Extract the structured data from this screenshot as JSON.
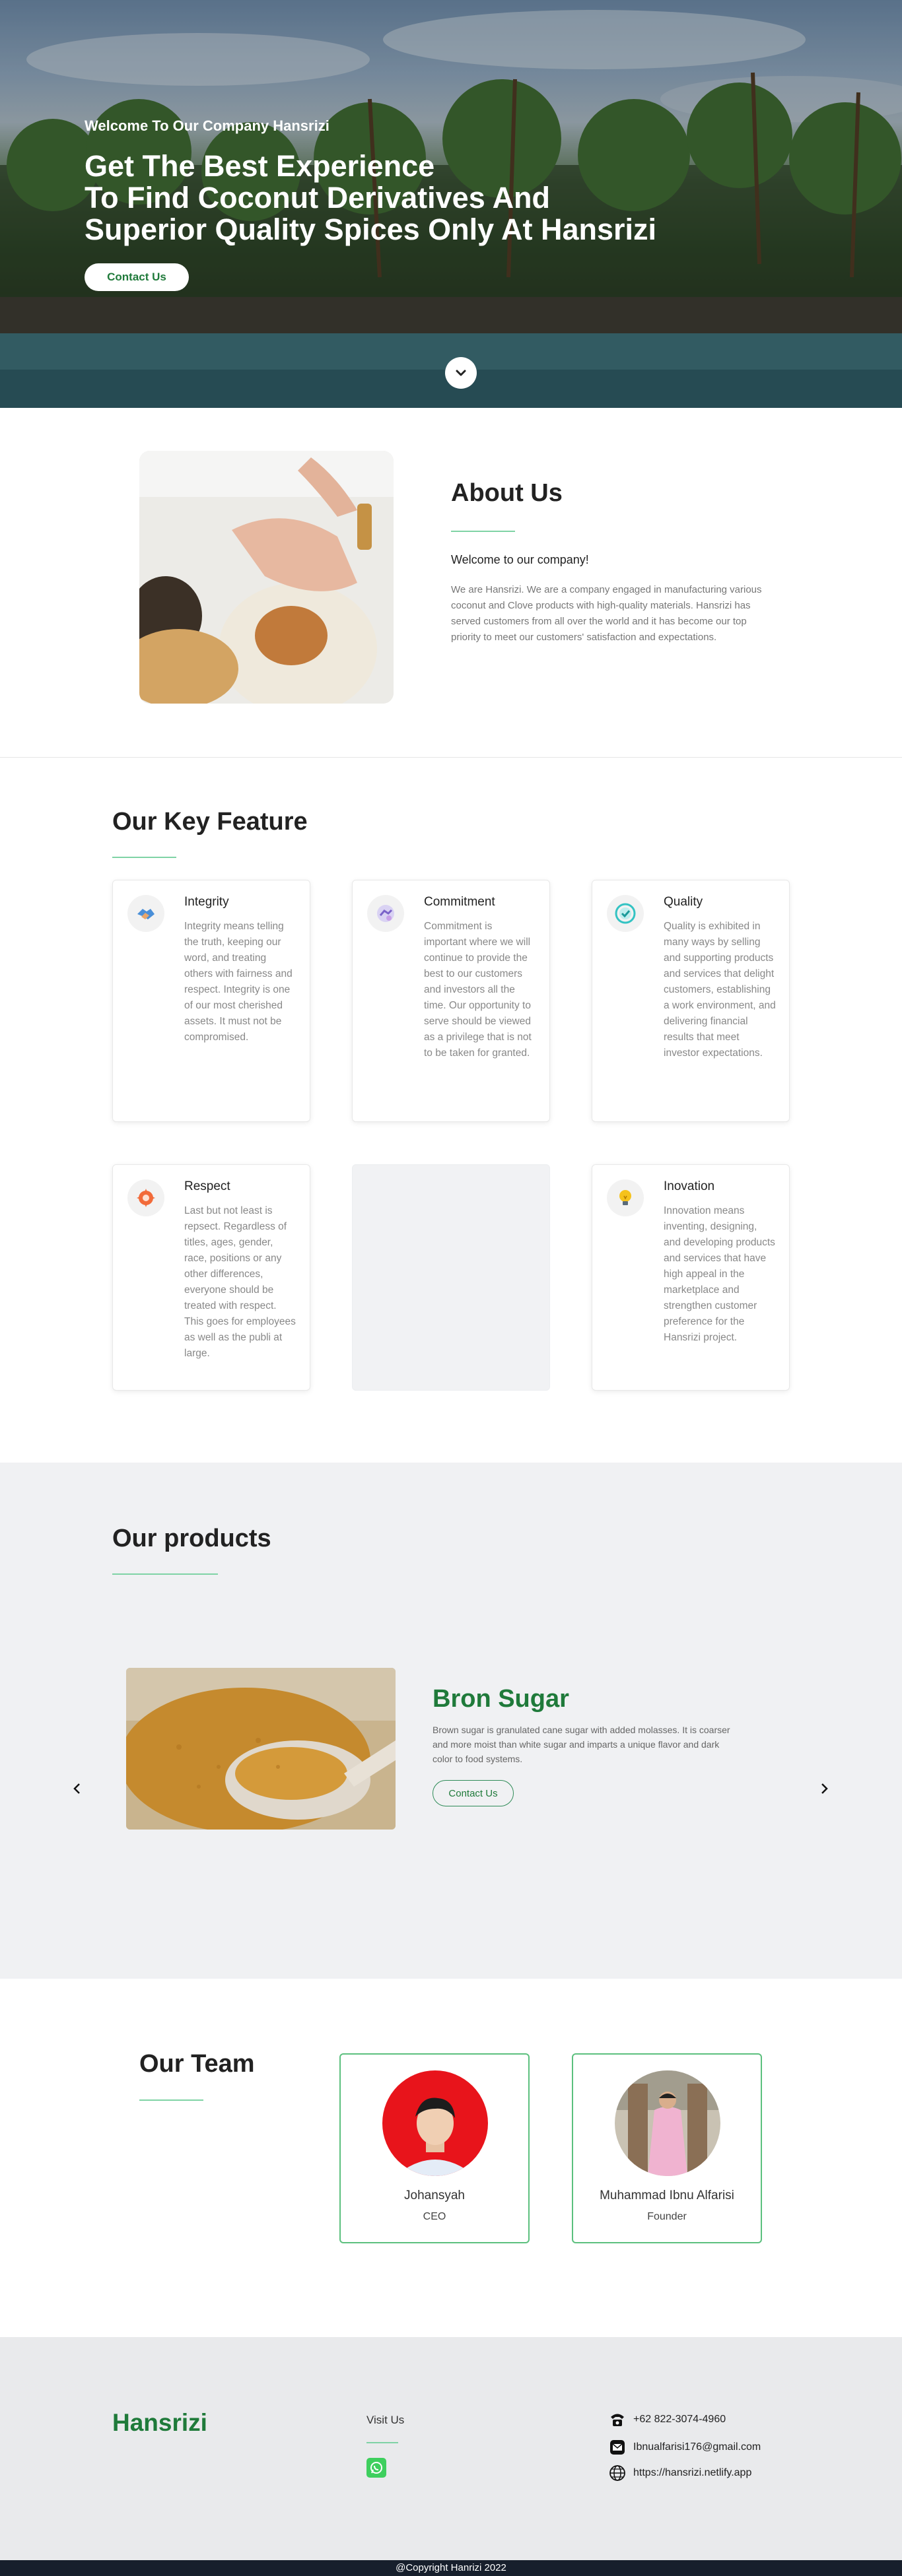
{
  "hero": {
    "subtitle": "Welcome To Our Company Hansrizi",
    "title_lines": [
      "Get The Best Experience",
      "To Find Coconut Derivatives And",
      "Superior Quality Spices Only At Hansrizi"
    ],
    "cta_label": "Contact Us",
    "scroll_icon": "chevron-down-icon"
  },
  "about": {
    "title": "About Us",
    "welcome": "Welcome to our company!",
    "text": "We are Hansrizi. We are a company engaged in manufacturing various coconut and Clove products with high-quality materials. Hansrizi has served customers from all over the world and it has become our top priority to meet our customers' satisfaction and expectations."
  },
  "features": {
    "title": "Our Key Feature",
    "items": [
      {
        "title": "Integrity",
        "icon": "handshake-icon",
        "text": "Integrity means telling the truth, keeping our word, and treating others with fairness and respect. Integrity is one of our most cherished assets. It must not be compromised."
      },
      {
        "title": "Commitment",
        "icon": "commitment-icon",
        "text": "Commitment is important where we will continue to provide the best to our customers and investors all the time. Our opportunity to serve should be viewed as a privilege that is not to be taken for granted."
      },
      {
        "title": "Quality",
        "icon": "quality-check-icon",
        "text": "Quality is exhibited in many ways by selling and supporting products and services that delight customers, establishing a work environment, and delivering financial results that meet investor expectations."
      },
      {
        "title": "Respect",
        "icon": "respect-icon",
        "text": "Last but not least is repsect. Regardless of titles, ages, gender, race, positions or any other differences, everyone should be treated with respect. This goes for employees as well as the publi at large."
      },
      {
        "title": "Inovation",
        "icon": "lightbulb-icon",
        "text": "Innovation means inventing, designing, and developing products and services that have high appeal in the marketplace and strengthen customer preference for the Hansrizi project."
      }
    ]
  },
  "products": {
    "title": "Our products",
    "current": {
      "name": "Bron Sugar",
      "description": "Brown sugar is granulated cane sugar with added molasses. It is coarser and more moist than white sugar and imparts a unique flavor and dark color to food systems.",
      "cta_label": "Contact Us"
    }
  },
  "team": {
    "title": "Our Team",
    "members": [
      {
        "name": "Johansyah",
        "role": "CEO"
      },
      {
        "name": "Muhammad Ibnu Alfarisi",
        "role": "Founder"
      }
    ]
  },
  "footer": {
    "brand": "Hansrizi",
    "visit_label": "Visit Us",
    "phone": "+62 822-3074-4960",
    "email": "Ibnualfarisi176@gmail.com",
    "website": "https://hansrizi.netlify.app",
    "copyright": "@Copyright Hanrizi 2022"
  },
  "colors": {
    "brand_green": "#1f7a3a",
    "accent_line": "#7fd3a5",
    "footer_bar": "#171f2c"
  }
}
